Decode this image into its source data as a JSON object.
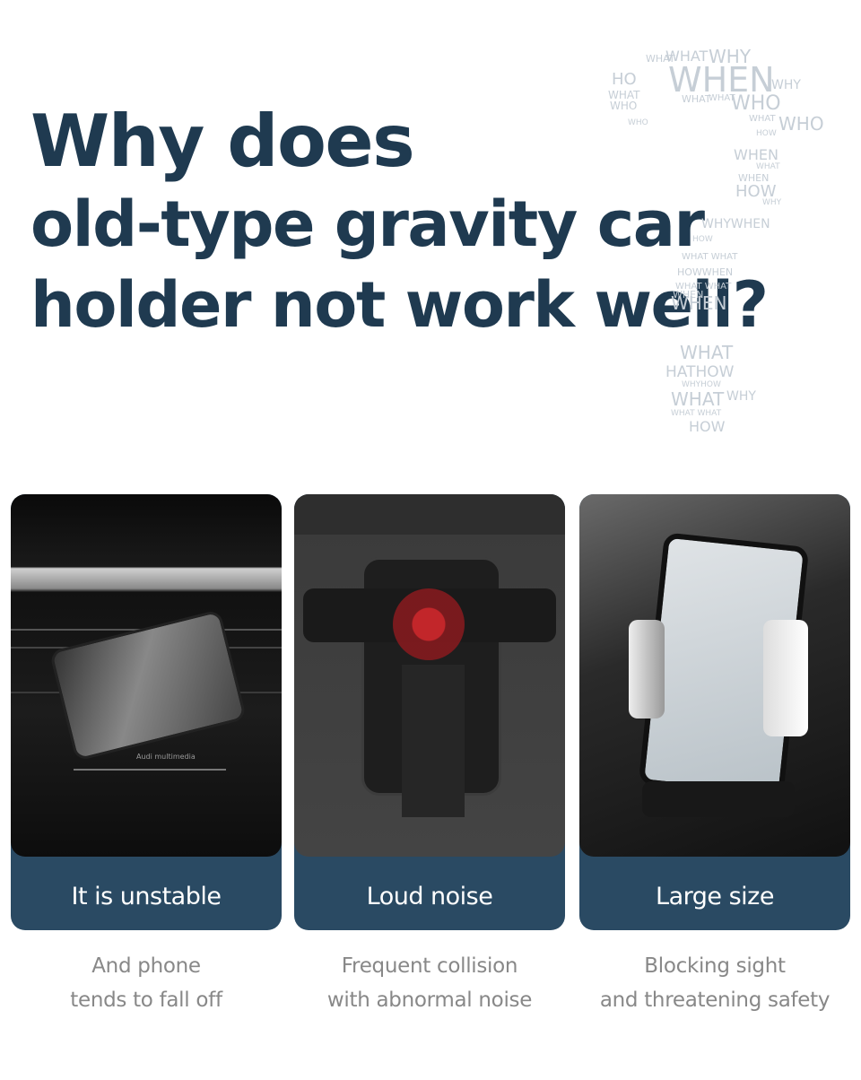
{
  "headline": {
    "lines": [
      "Why does",
      "old-type gravity car",
      "holder not work well?"
    ],
    "color": "#1f3a50"
  },
  "word_cloud": {
    "shape": "question-mark",
    "color": "#c6ced6",
    "words": [
      "WHAT",
      "WHY",
      "HO",
      "WHEN",
      "WHY",
      "WHAT",
      "WHO",
      "WHAT",
      "WHAT",
      "WHAT",
      "WHO",
      "WHO",
      "WHAT",
      "WHO",
      "HOW",
      "WHEN",
      "WHAT",
      "WHEN",
      "HOW",
      "WHY",
      "WHYWHEN",
      "HOW",
      "WHAT WHAT",
      "HOWWHEN",
      "WHAT WHAT",
      "WHEN",
      "WHEN",
      "WHAT",
      "HATHOW",
      "WHYHOW",
      "WHAT",
      "WHY",
      "WHAT WHAT",
      "HOW"
    ]
  },
  "cards": [
    {
      "label": "It is unstable",
      "desc_lines": [
        "And phone",
        "tends to fall off"
      ],
      "photo": "phone-falling-in-car-vent",
      "photo_caption": "Audi multimedia"
    },
    {
      "label": "Loud noise",
      "desc_lines": [
        "Frequent collision",
        "with abnormal noise"
      ],
      "photo": "gravity-holder-closeup"
    },
    {
      "label": "Large size",
      "desc_lines": [
        "Blocking sight",
        "and threatening safety"
      ],
      "photo": "bulky-holder-with-phone-map"
    }
  ],
  "colors": {
    "card": "#2a4a63",
    "desc_text": "#888888",
    "accent_red": "#c0282d"
  }
}
